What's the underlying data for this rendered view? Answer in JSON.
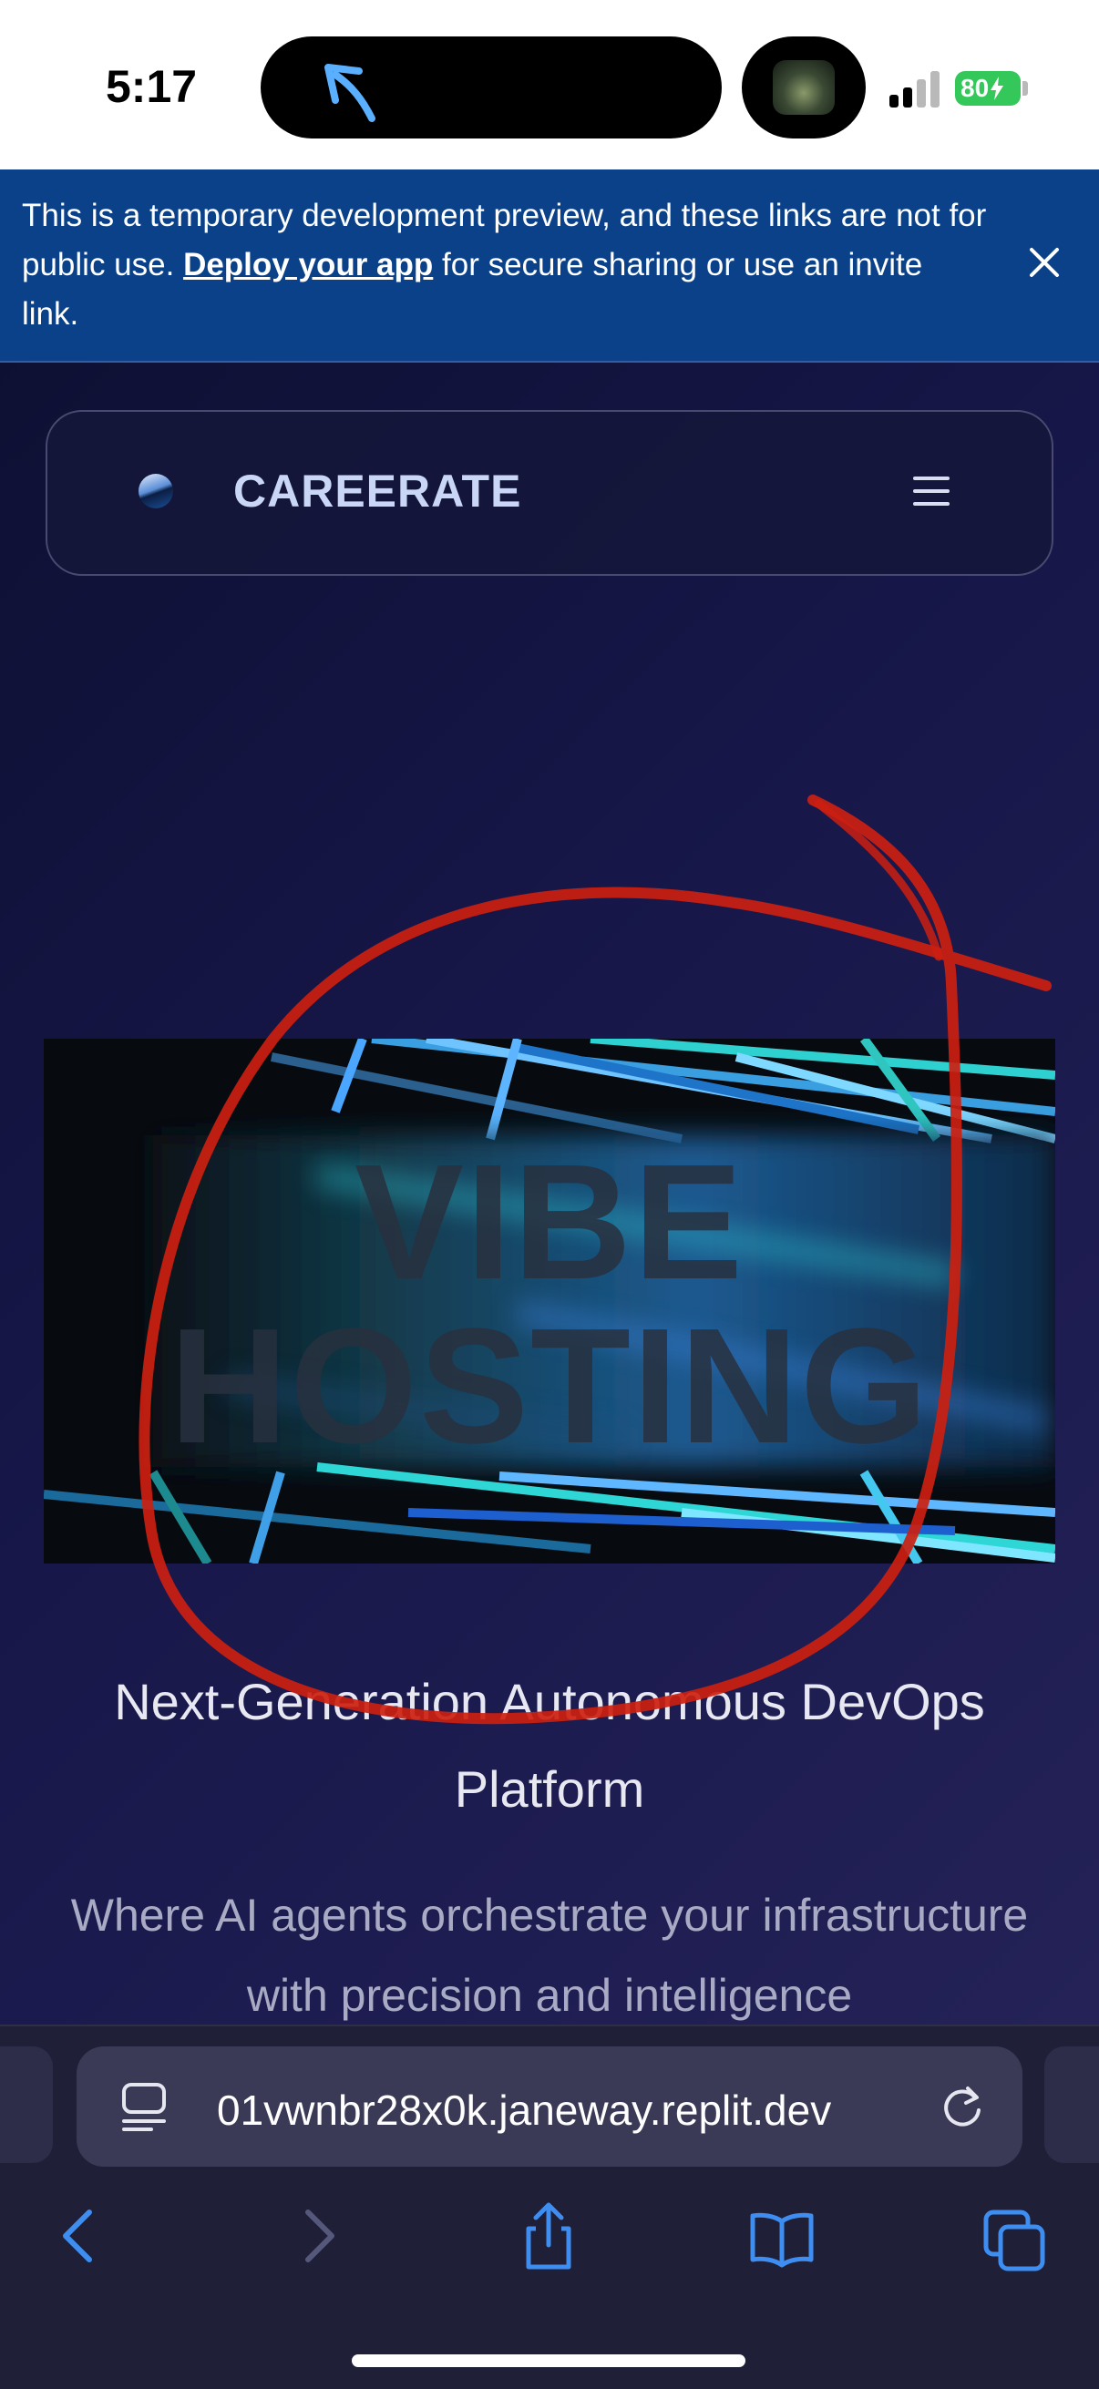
{
  "status_bar": {
    "time": "5:17",
    "battery": "80"
  },
  "banner": {
    "text_before": "This is a temporary development preview, and these links are not for public use. ",
    "link": "Deploy your app",
    "text_after": " for secure sharing or use an invite link."
  },
  "nav": {
    "brand": "CAREERATE"
  },
  "hero": {
    "line1": "VIBE",
    "line2": "HOSTING"
  },
  "content": {
    "subtitle": "Next-Generation Autonomous DevOps Platform",
    "description": "Where AI agents orchestrate your infrastructure with precision and intelligence"
  },
  "browser": {
    "url": "01vwnbr28x0k.janeway.replit.dev"
  },
  "colors": {
    "banner": "#0a4188",
    "brand_text": "#c9d6f6",
    "accent_blue": "#3d8ef0",
    "annotation_red": "#cc1f10",
    "battery_green": "#34c759"
  },
  "icons": {
    "island_arrow": "arrow-up-left-icon",
    "close": "close-icon",
    "menu": "hamburger-menu-icon",
    "reader": "reader-mode-icon",
    "reload": "reload-icon",
    "back": "chevron-left-icon",
    "forward": "chevron-right-icon",
    "share": "share-icon",
    "bookmarks": "book-icon",
    "tabs": "tabs-icon"
  }
}
